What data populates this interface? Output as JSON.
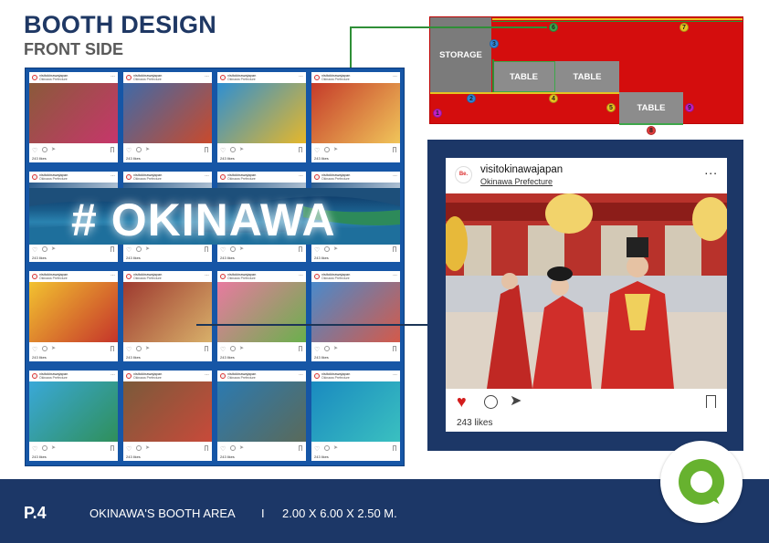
{
  "header": {
    "title": "BOOTH DESIGN",
    "subtitle": "FRONT SIDE"
  },
  "floor_plan": {
    "zones": [
      {
        "label": "STORAGE"
      },
      {
        "label": "TABLE"
      },
      {
        "label": "TABLE"
      },
      {
        "label": "TABLE"
      }
    ],
    "markers": [
      {
        "num": "1",
        "color": "#c41fc4"
      },
      {
        "num": "2",
        "color": "#2f86d8"
      },
      {
        "num": "3",
        "color": "#2f86d8"
      },
      {
        "num": "4",
        "color": "#e7c320"
      },
      {
        "num": "5",
        "color": "#e7c320"
      },
      {
        "num": "6",
        "color": "#3da64a"
      },
      {
        "num": "7",
        "color": "#e7c320"
      },
      {
        "num": "8",
        "color": "#e33b3b"
      },
      {
        "num": "9",
        "color": "#c41fc4"
      }
    ],
    "colors": {
      "floor": "#d40d0d",
      "storage": "#7b7b7b",
      "table": "#8c8c8c"
    }
  },
  "wall": {
    "banner_text": "# OKINAWA",
    "post_account": "visitokinawajapan",
    "post_location": "Okinawa Prefecture",
    "post_likes": "243 likes"
  },
  "featured_post": {
    "account": "visitokinawajapan",
    "location": "Okinawa Prefecture",
    "likes": "243 likes",
    "more": "...",
    "avatar_text": "Be."
  },
  "footer": {
    "page": "P.4",
    "area": "OKINAWA'S BOOTH AREA",
    "separator": "I",
    "size": "2.00 X 6.00 X 2.50 M."
  },
  "colors": {
    "navy": "#1c3767",
    "brand_green": "#67b22f",
    "wall_blue": "#1656a6",
    "heart_red": "#d31d1d"
  }
}
